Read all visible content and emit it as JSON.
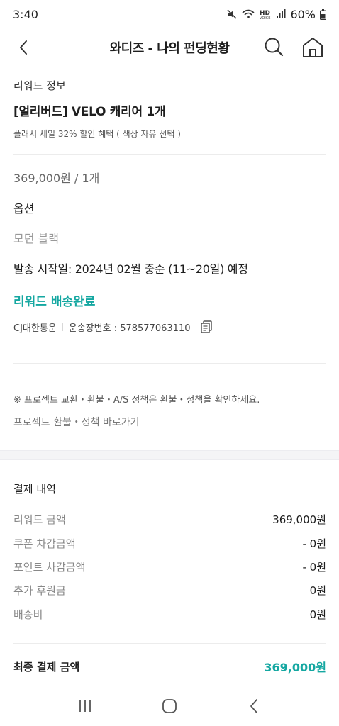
{
  "status_bar": {
    "time": "3:40",
    "battery": "60%",
    "icons": [
      "mute-icon",
      "wifi-icon",
      "hd-voice-icon",
      "signal-icon",
      "battery-icon"
    ]
  },
  "header": {
    "title": "와디즈 - 나의 펀딩현황",
    "icons": [
      "back-arrow-icon",
      "search-icon",
      "home-icon"
    ]
  },
  "reward": {
    "section_label": "리워드 정보",
    "title": "[얼리버드] VELO 캐리어 1개",
    "description": "플래시 세일 32% 할인 혜택 ( 색상 자유 선택 )",
    "price_qty": "369,000원 / 1개",
    "option_label": "옵션",
    "option_value": "모던 블랙",
    "ship_start": "발송 시작일: 2024년 02월 중순 (11~20일) 예정",
    "delivery_status": "리워드 배송완료",
    "carrier": "CJ대한통운",
    "tracking": "운송장번호 : 578577063110"
  },
  "policy": {
    "notice": "※ 프로젝트 교환・환불・A/S 정책은 환불・정책을 확인하세요.",
    "link": "프로젝트 환불・정책 바로가기"
  },
  "payment": {
    "title": "결제 내역",
    "rows": [
      {
        "label": "리워드 금액",
        "value": "369,000원"
      },
      {
        "label": "쿠폰 차감금액",
        "value": "- 0원"
      },
      {
        "label": "포인트 차감금액",
        "value": "- 0원"
      },
      {
        "label": "추가 후원금",
        "value": "0원"
      },
      {
        "label": "배송비",
        "value": "0원"
      }
    ],
    "final_label": "최종 결제 금액",
    "final_value": "369,000원"
  },
  "colors": {
    "accent": "#14a7a1",
    "text": "#1e1e1e",
    "muted": "#888888"
  }
}
